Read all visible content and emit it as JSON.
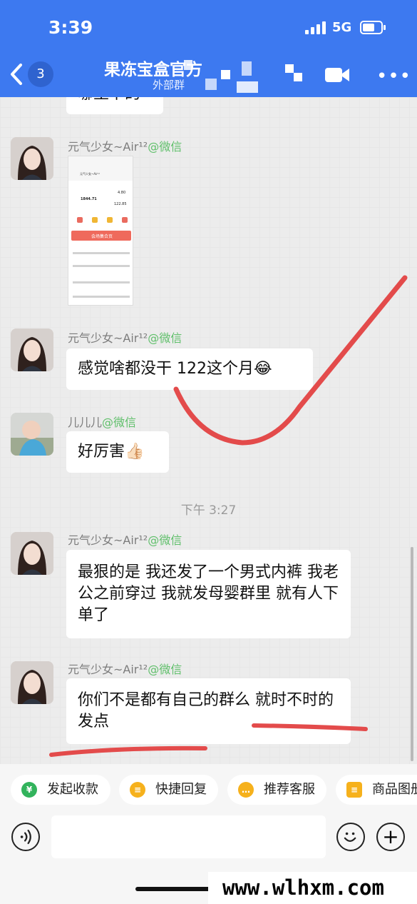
{
  "status_bar": {
    "time": "3:39",
    "network": "5G"
  },
  "header": {
    "unread_count": "3",
    "title": "果冻宝盒官方",
    "subtitle": "外部群"
  },
  "messages": [
    {
      "sender_name": "元气少女~Air¹²",
      "sender_channel": "@微信",
      "type": "image",
      "image": {
        "user": "元气少女~Air¹²",
        "balance": "1844.71",
        "stat": "4.80",
        "amount": "122.85",
        "banner_text": "会场集合页"
      }
    },
    {
      "sender_name": "元气少女~Air¹²",
      "sender_channel": "@微信",
      "text": "感觉啥都没干 122这个月😂"
    },
    {
      "sender_name": "儿儿儿",
      "sender_channel": "@微信",
      "text": "好厉害👍🏻"
    },
    {
      "sender_name": "元气少女~Air¹²",
      "sender_channel": "@微信",
      "text": "最狠的是 我还发了一个男式内裤 我老公之前穿过 我就发母婴群里 就有人下单了"
    },
    {
      "sender_name": "元气少女~Air¹²",
      "sender_channel": "@微信",
      "text": "你们不是都有自己的群么 就时不时的发点"
    }
  ],
  "previous_message_fragment": "哪里下的",
  "time_divider": "下午 3:27",
  "quick_replies": [
    {
      "label": "发起收款",
      "icon": "¥",
      "color": "#32b35c"
    },
    {
      "label": "快捷回复",
      "icon": "≡",
      "color": "#f6b11c"
    },
    {
      "label": "推荐客服",
      "icon": "…",
      "color": "#f6b11c"
    },
    {
      "label": "商品图册",
      "icon": "≡",
      "color": "#f6b11c"
    }
  ],
  "watermark": "www.wlhxm.com",
  "colors": {
    "header": "#3d79f0",
    "annotation": "#e34b4b"
  }
}
